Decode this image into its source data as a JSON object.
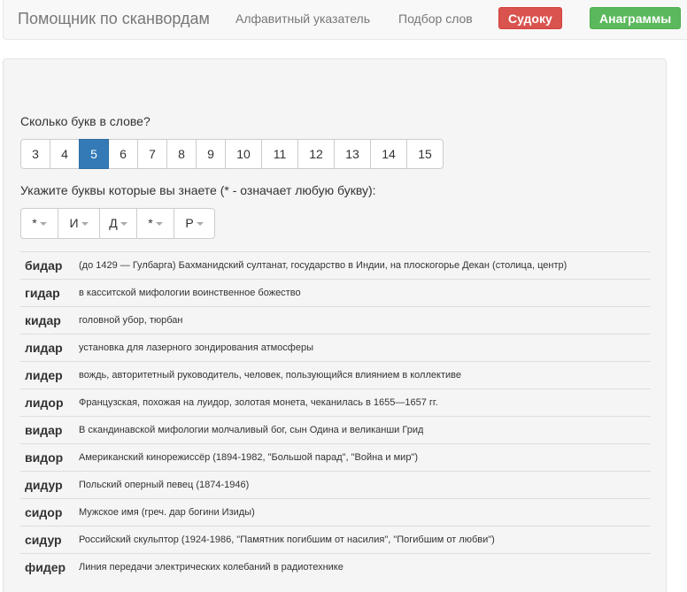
{
  "navbar": {
    "brand": "Помощник по сканвордам",
    "links": [
      "Алфавитный указатель",
      "Подбор слов"
    ],
    "sudoku_button": "Судоку",
    "anagram_button": "Анаграммы"
  },
  "length": {
    "question": "Сколько букв в слове?",
    "options": [
      "3",
      "4",
      "5",
      "6",
      "7",
      "8",
      "9",
      "10",
      "11",
      "12",
      "13",
      "14",
      "15"
    ],
    "selected": "5"
  },
  "letters": {
    "prompt": "Укажите буквы которые вы знаете (* - означает любую букву):",
    "values": [
      "*",
      "И",
      "Д",
      "*",
      "Р"
    ]
  },
  "results": [
    {
      "word": "бидар",
      "definition": "(до 1429 — Гулбарга) Бахманидский султанат, государство в Индии, на плоскогорье Декан (столица, центр)"
    },
    {
      "word": "гидар",
      "definition": "в касситской мифологии воинственное божество"
    },
    {
      "word": "кидар",
      "definition": "головной убор, тюрбан"
    },
    {
      "word": "лидар",
      "definition": "установка для лазерного зондирования атмосферы"
    },
    {
      "word": "лидер",
      "definition": "вождь, авторитетный руководитель, человек, пользующийся влиянием в коллективе"
    },
    {
      "word": "лидор",
      "definition": "Французская, похожая на луидор, золотая монета, чеканилась в 1655—1657 гг."
    },
    {
      "word": "видар",
      "definition": "В скандинавской мифологии молчаливый бог, сын Одина и великанши Грид"
    },
    {
      "word": "видор",
      "definition": "Американский кинорежиссёр (1894-1982, \"Большой парад\", \"Война и мир\")"
    },
    {
      "word": "дидур",
      "definition": "Польский оперный певец (1874-1946)"
    },
    {
      "word": "сидор",
      "definition": "Мужское имя (греч. дар богини Изиды)"
    },
    {
      "word": "сидур",
      "definition": "Российский скульптор (1924-1986, \"Памятник погибшим от насилия\", \"Погибшим от любви\")"
    },
    {
      "word": "фидер",
      "definition": "Линия передачи электрических колебаний в радиотехнике"
    }
  ]
}
